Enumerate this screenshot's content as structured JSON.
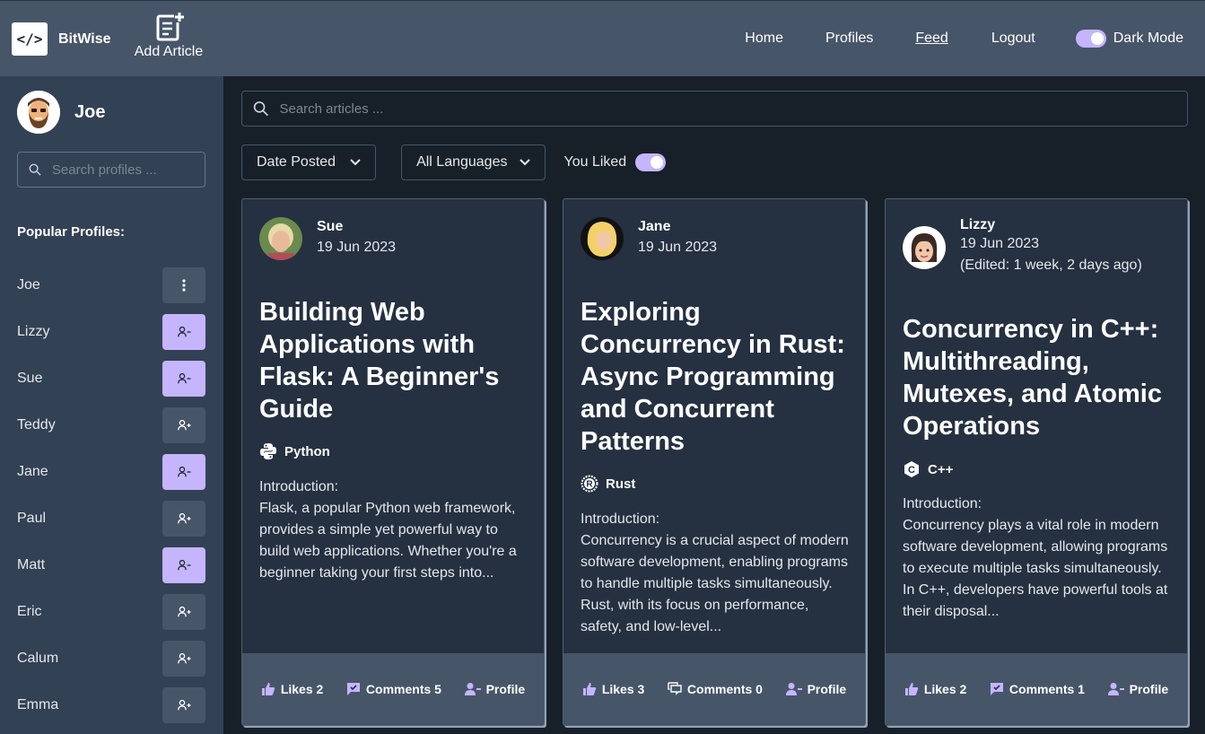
{
  "header": {
    "brand": "BitWise",
    "add_article": "Add Article",
    "nav": [
      "Home",
      "Profiles",
      "Feed",
      "Logout"
    ],
    "dark_mode": "Dark Mode",
    "dark_mode_on": true
  },
  "sidebar": {
    "user": "Joe",
    "search_placeholder": "Search profiles ...",
    "popular_title": "Popular Profiles:",
    "profiles": [
      {
        "name": "Joe",
        "action": "more"
      },
      {
        "name": "Lizzy",
        "action": "unfollow"
      },
      {
        "name": "Sue",
        "action": "unfollow"
      },
      {
        "name": "Teddy",
        "action": "follow"
      },
      {
        "name": "Jane",
        "action": "unfollow"
      },
      {
        "name": "Paul",
        "action": "follow"
      },
      {
        "name": "Matt",
        "action": "unfollow"
      },
      {
        "name": "Eric",
        "action": "follow"
      },
      {
        "name": "Calum",
        "action": "follow"
      },
      {
        "name": "Emma",
        "action": "follow"
      }
    ]
  },
  "main": {
    "search_placeholder": "Search articles ...",
    "sort": "Date Posted",
    "language": "All Languages",
    "you_liked": "You Liked",
    "you_liked_on": true
  },
  "articles": [
    {
      "author": "Sue",
      "date": "19 Jun 2023",
      "title": "Building Web Applications with Flask: A Beginner's Guide",
      "language": "Python",
      "excerpt_heading": "Introduction:",
      "excerpt": "Flask, a popular Python web framework, provides a simple yet powerful way to build web applications. Whether you're a beginner taking your first steps into...",
      "likes": "Likes 2",
      "comments": "Comments 5",
      "profile": "Profile"
    },
    {
      "author": "Jane",
      "date": "19 Jun 2023",
      "title": "Exploring Concurrency in Rust: Async Programming and Concurrent Patterns",
      "language": "Rust",
      "excerpt_heading": "Introduction:",
      "excerpt": "Concurrency is a crucial aspect of modern software development, enabling programs to handle multiple tasks simultaneously. Rust, with its focus on performance, safety, and low-level...",
      "likes": "Likes 3",
      "comments": "Comments 0",
      "profile": "Profile"
    },
    {
      "author": "Lizzy",
      "date": "19 Jun 2023",
      "edited": "(Edited: 1 week, 2 days ago)",
      "title": "Concurrency in C++: Multithreading, Mutexes, and Atomic Operations",
      "language": "C++",
      "excerpt_heading": "Introduction:",
      "excerpt": "Concurrency plays a vital role in modern software development, allowing programs to execute multiple tasks simultaneously. In C++, developers have powerful tools at their disposal...",
      "likes": "Likes 2",
      "comments": "Comments 1",
      "profile": "Profile"
    }
  ],
  "colors": {
    "accent": "#c4b5fd",
    "header": "#475569",
    "sidebar": "#334155",
    "background": "#172029",
    "card": "#253141"
  }
}
